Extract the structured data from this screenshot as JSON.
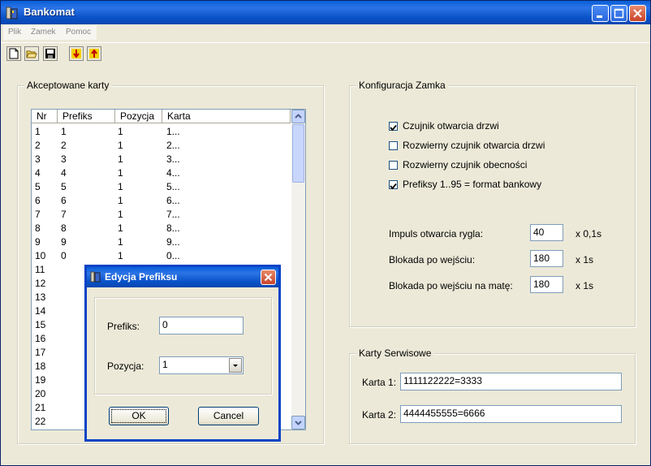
{
  "window": {
    "title": "Bankomat"
  },
  "menu": {
    "items": [
      "Plik",
      "Zamek",
      "Pomoc"
    ]
  },
  "toolbar": {
    "icons": [
      "new-file-icon",
      "open-folder-icon",
      "save-icon",
      "download-arrow-icon",
      "upload-arrow-icon"
    ]
  },
  "cards_group": {
    "title": "Akceptowane karty",
    "columns": [
      "Nr",
      "Prefiks",
      "Pozycja",
      "Karta"
    ],
    "rows": [
      [
        "1",
        "1",
        "1",
        "1..."
      ],
      [
        "2",
        "2",
        "1",
        "2..."
      ],
      [
        "3",
        "3",
        "1",
        "3..."
      ],
      [
        "4",
        "4",
        "1",
        "4..."
      ],
      [
        "5",
        "5",
        "1",
        "5..."
      ],
      [
        "6",
        "6",
        "1",
        "6..."
      ],
      [
        "7",
        "7",
        "1",
        "7..."
      ],
      [
        "8",
        "8",
        "1",
        "8..."
      ],
      [
        "9",
        "9",
        "1",
        "9..."
      ],
      [
        "10",
        "0",
        "1",
        "0..."
      ],
      [
        "11",
        "",
        "",
        ""
      ],
      [
        "12",
        "",
        "",
        ""
      ],
      [
        "13",
        "",
        "",
        ""
      ],
      [
        "14",
        "",
        "",
        ""
      ],
      [
        "15",
        "",
        "",
        ""
      ],
      [
        "16",
        "",
        "",
        ""
      ],
      [
        "17",
        "",
        "",
        ""
      ],
      [
        "18",
        "",
        "",
        ""
      ],
      [
        "19",
        "",
        "",
        ""
      ],
      [
        "20",
        "",
        "",
        ""
      ],
      [
        "21",
        "",
        "",
        ""
      ],
      [
        "22",
        "",
        "",
        ""
      ]
    ]
  },
  "lock_config": {
    "title": "Konfiguracja Zamka",
    "checkboxes": [
      {
        "label": "Czujnik otwarcia drzwi",
        "checked": true
      },
      {
        "label": "Rozwierny czujnik otwarcia drzwi",
        "checked": false
      },
      {
        "label": "Rozwierny czujnik obecności",
        "checked": false
      },
      {
        "label": "Prefiksy 1..95 = format bankowy",
        "checked": true
      }
    ],
    "fields": [
      {
        "label": "Impuls otwarcia rygla:",
        "value": "40",
        "unit": "x 0,1s"
      },
      {
        "label": "Blokada po wejściu:",
        "value": "180",
        "unit": "x 1s"
      },
      {
        "label": "Blokada po wejściu na matę:",
        "value": "180",
        "unit": "x 1s"
      }
    ]
  },
  "service_cards": {
    "title": "Karty Serwisowe",
    "card1_label": "Karta 1:",
    "card1_value": "1111122222=3333",
    "card2_label": "Karta 2:",
    "card2_value": "4444455555=6666"
  },
  "dialog": {
    "title": "Edycja Prefiksu",
    "prefix_label": "Prefiks:",
    "prefix_value": "0",
    "position_label": "Pozycja:",
    "position_value": "1",
    "ok_label": "OK",
    "cancel_label": "Cancel"
  },
  "colors": {
    "titlebar": "#0a5fd8",
    "window_bg": "#ece9d8",
    "checkmark": "#21a121"
  }
}
